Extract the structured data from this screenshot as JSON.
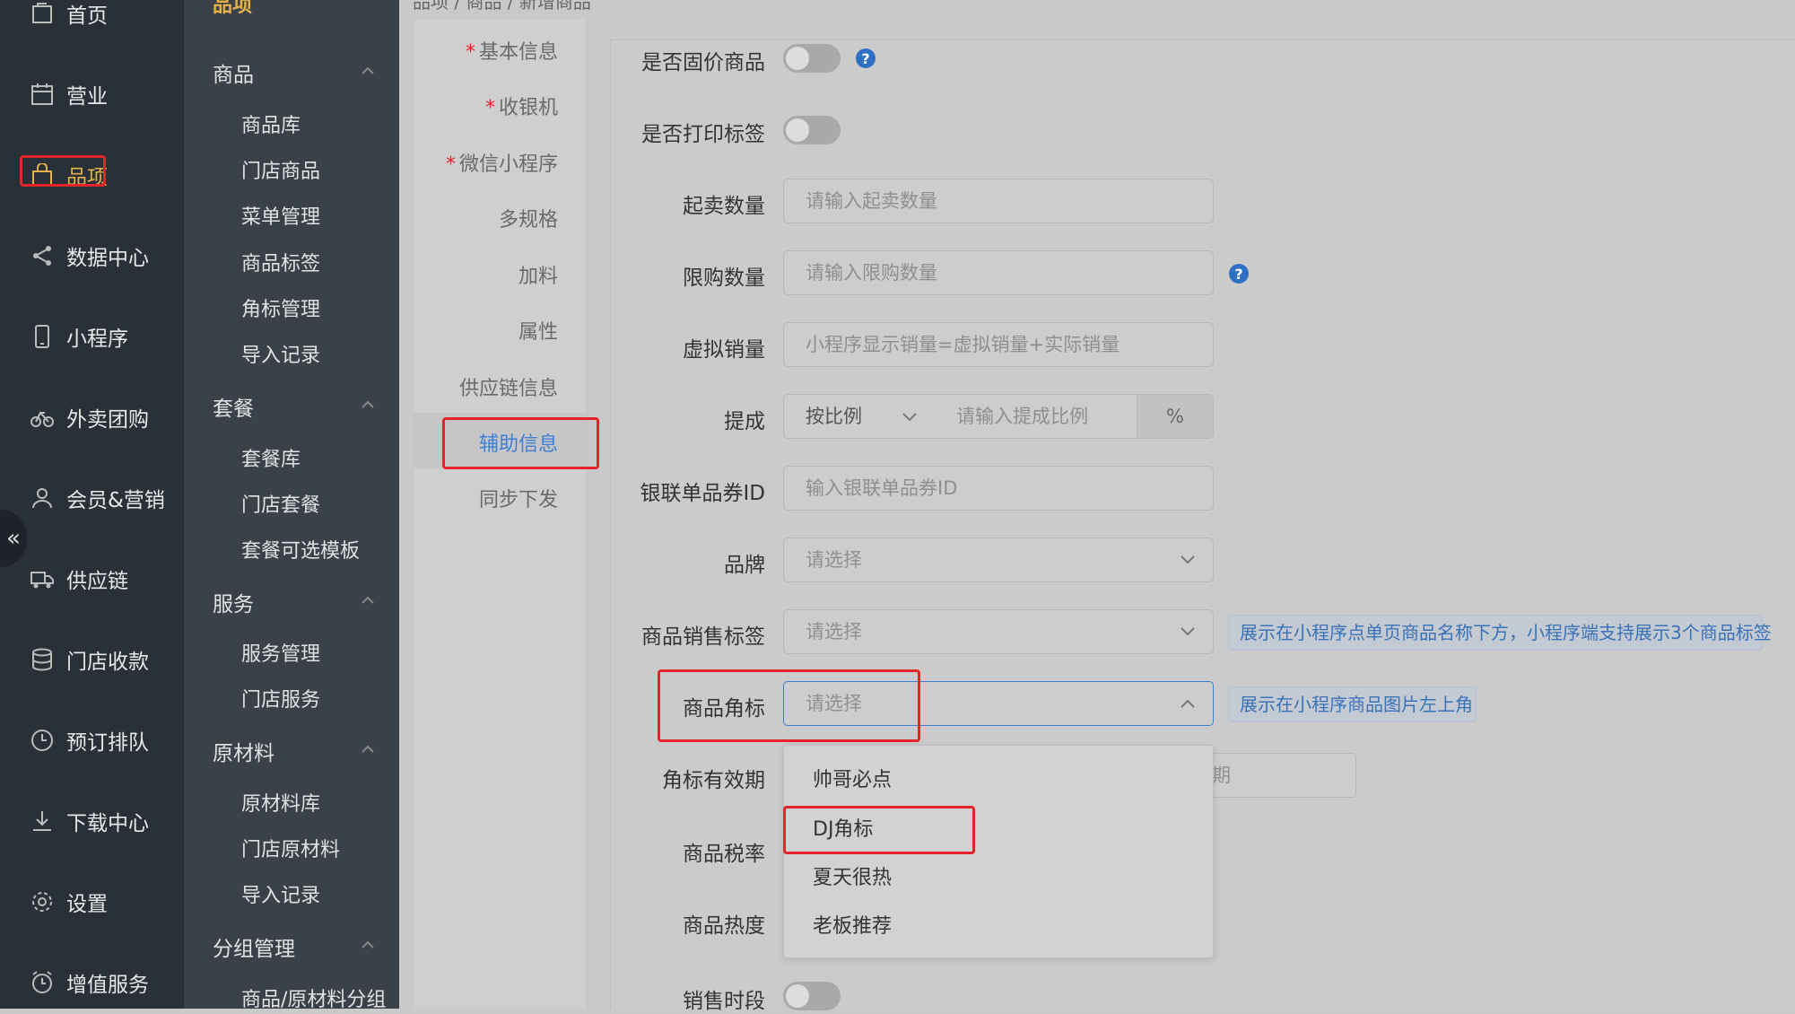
{
  "nav_primary": {
    "items": [
      {
        "label": "首页",
        "icon": "home-icon"
      },
      {
        "label": "营业",
        "icon": "calendar-icon"
      },
      {
        "label": "品项",
        "icon": "shopping-bag-icon"
      },
      {
        "label": "数据中心",
        "icon": "share-icon"
      },
      {
        "label": "小程序",
        "icon": "mobile-icon"
      },
      {
        "label": "外卖团购",
        "icon": "bike-icon"
      },
      {
        "label": "会员&营销",
        "icon": "user-icon"
      },
      {
        "label": "供应链",
        "icon": "truck-icon"
      },
      {
        "label": "门店收款",
        "icon": "database-icon"
      },
      {
        "label": "预订排队",
        "icon": "clock-icon"
      },
      {
        "label": "下载中心",
        "icon": "download-icon"
      },
      {
        "label": "设置",
        "icon": "gear-icon"
      },
      {
        "label": "增值服务",
        "icon": "alarm-icon"
      }
    ],
    "collapse_glyph": "«"
  },
  "nav_secondary": {
    "title": "品项",
    "groups": [
      {
        "label": "商品",
        "items": [
          "商品库",
          "门店商品",
          "菜单管理",
          "商品标签",
          "角标管理",
          "导入记录"
        ]
      },
      {
        "label": "套餐",
        "items": [
          "套餐库",
          "门店套餐",
          "套餐可选模板"
        ]
      },
      {
        "label": "服务",
        "items": [
          "服务管理",
          "门店服务"
        ]
      },
      {
        "label": "原材料",
        "items": [
          "原材料库",
          "门店原材料",
          "导入记录"
        ]
      },
      {
        "label": "分组管理",
        "items": [
          "商品/原材料分组"
        ]
      }
    ]
  },
  "breadcrumb": "品项 / 商品 / 新增商品",
  "tabs": [
    {
      "label": "基本信息",
      "required": "*"
    },
    {
      "label": "收银机",
      "required": "*"
    },
    {
      "label": "微信小程序",
      "required": "*"
    },
    {
      "label": "多规格",
      "required": ""
    },
    {
      "label": "加料",
      "required": ""
    },
    {
      "label": "属性",
      "required": ""
    },
    {
      "label": "供应链信息",
      "required": ""
    },
    {
      "label": "辅助信息",
      "required": ""
    },
    {
      "label": "同步下发",
      "required": ""
    }
  ],
  "form": {
    "fixed_price": {
      "label": "是否固价商品",
      "help": "?"
    },
    "print_label": {
      "label": "是否打印标签"
    },
    "min_qty": {
      "label": "起卖数量",
      "placeholder": "请输入起卖数量"
    },
    "limit_qty": {
      "label": "限购数量",
      "placeholder": "请输入限购数量",
      "help": "?"
    },
    "virtual_sales": {
      "label": "虚拟销量",
      "placeholder": "小程序显示销量=虚拟销量+实际销量"
    },
    "commission": {
      "label": "提成",
      "mode": "按比例",
      "placeholder": "请输入提成比例",
      "unit": "%"
    },
    "unionpay_id": {
      "label": "银联单品券ID",
      "placeholder": "输入银联单品券ID"
    },
    "brand": {
      "label": "品牌",
      "placeholder": "请选择"
    },
    "sales_tag": {
      "label": "商品销售标签",
      "placeholder": "请选择",
      "hint": "展示在小程序点单页商品名称下方，小程序端支持展示3个商品标签"
    },
    "corner_tag": {
      "label": "商品角标",
      "placeholder": "请选择",
      "hint": "展示在小程序商品图片左上角"
    },
    "corner_validity": {
      "label": "角标有效期",
      "partial_text": "期"
    },
    "tax_rate": {
      "label": "商品税率"
    },
    "heat": {
      "label": "商品热度"
    },
    "sale_period": {
      "label": "销售时段"
    }
  },
  "dropdown": {
    "options": [
      "帅哥必点",
      "DJ角标",
      "夏天很热",
      "老板推荐"
    ]
  },
  "colors": {
    "accent": "#3d7fd4",
    "nav_active": "#e3b248",
    "highlight": "#e3242b",
    "nav_dark": "#2a3038"
  }
}
